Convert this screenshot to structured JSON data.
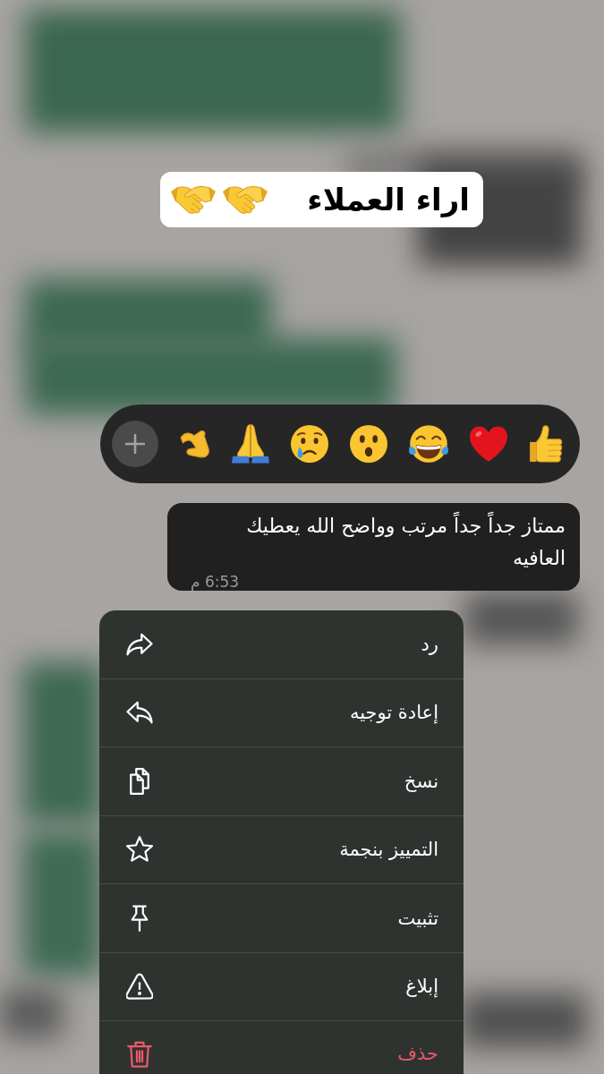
{
  "title": {
    "text": "اراء العملاء",
    "emojis": [
      {
        "kind": "handshake"
      },
      {
        "kind": "handshake"
      }
    ]
  },
  "reactions": [
    {
      "kind": "thumbs_up"
    },
    {
      "kind": "heart"
    },
    {
      "kind": "tears_of_joy"
    },
    {
      "kind": "surprised"
    },
    {
      "kind": "crying"
    },
    {
      "kind": "praying"
    },
    {
      "kind": "heart_hands"
    }
  ],
  "message": {
    "text": "ممتاز جداً جداً مرتب وواضح الله يعطيك العافيه",
    "time": "6:53 م"
  },
  "menu": [
    {
      "label": "رد",
      "kind": "reply",
      "destructive": false
    },
    {
      "label": "إعادة توجيه",
      "kind": "forward",
      "destructive": false
    },
    {
      "label": "نسخ",
      "kind": "copy",
      "destructive": false
    },
    {
      "label": "التمييز بنجمة",
      "kind": "star",
      "destructive": false
    },
    {
      "label": "تثبيت",
      "kind": "pin",
      "destructive": false
    },
    {
      "label": "إبلاغ",
      "kind": "report",
      "destructive": false
    },
    {
      "label": "حذف",
      "kind": "delete",
      "destructive": true
    }
  ]
}
